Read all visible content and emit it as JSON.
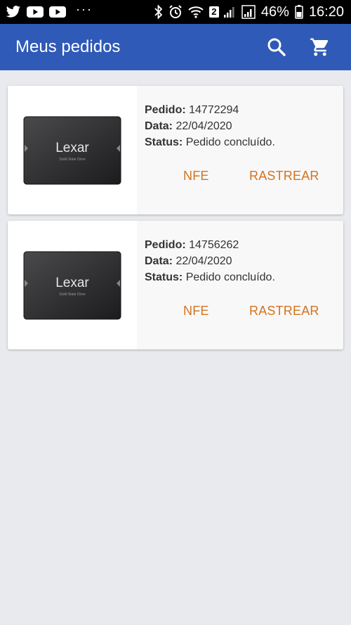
{
  "status_bar": {
    "left_icons": [
      "twitter-icon",
      "youtube-icon",
      "youtube-icon",
      "more-dots-icon"
    ],
    "more_dots": "···",
    "right_icons": [
      "bluetooth-icon",
      "alarm-icon",
      "wifi-icon",
      "sim2-signal-icon",
      "signal-icon",
      "battery-icon"
    ],
    "sim_number": "2",
    "battery": "46%",
    "time": "16:20"
  },
  "appbar": {
    "title": "Meus pedidos",
    "search_icon": "search-icon",
    "cart_icon": "cart-icon",
    "color": "#2f5ab7"
  },
  "orders": [
    {
      "product_brand": "Lexar",
      "product_subtitle": "Solid State Drive",
      "pedido_label": "Pedido:",
      "pedido": "14772294",
      "data_label": "Data:",
      "data": "22/04/2020",
      "status_label": "Status:",
      "status": "Pedido concluído.",
      "nfe_label": "NFE",
      "rastrear_label": "RASTREAR"
    },
    {
      "product_brand": "Lexar",
      "product_subtitle": "Solid State Drive",
      "pedido_label": "Pedido:",
      "pedido": "14756262",
      "data_label": "Data:",
      "data": "22/04/2020",
      "status_label": "Status:",
      "status": "Pedido concluído.",
      "nfe_label": "NFE",
      "rastrear_label": "RASTREAR"
    }
  ],
  "colors": {
    "action": "#d4731e",
    "background": "#e9eaee"
  }
}
